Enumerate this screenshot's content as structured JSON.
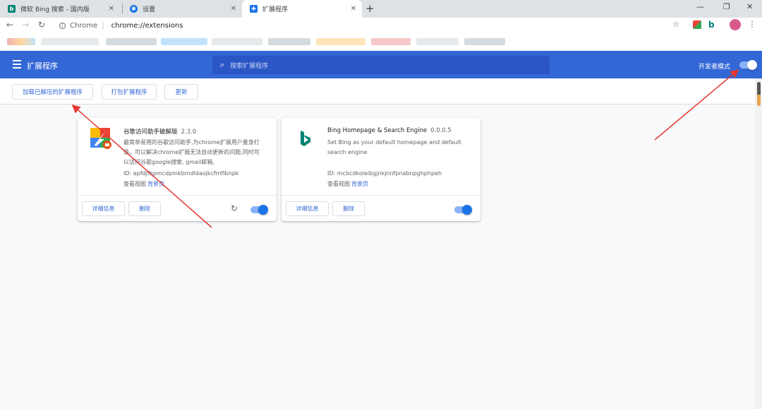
{
  "browser": {
    "tabs": [
      {
        "title": "微软 Bing 搜索 - 国内版",
        "icon": "bing-icon",
        "active": false
      },
      {
        "title": "设置",
        "icon": "settings-gear-icon",
        "active": false
      },
      {
        "title": "扩展程序",
        "icon": "puzzle-icon",
        "active": true
      }
    ],
    "newtab": "+",
    "address": {
      "scheme_label": "Chrome",
      "separator": "|",
      "url": "chrome://extensions"
    }
  },
  "header": {
    "title": "扩展程序",
    "search_placeholder": "搜索扩展程序",
    "dev_mode_label": "开发者模式",
    "dev_mode_on": true
  },
  "subbar": {
    "load_unpacked": "加载已解压的扩展程序",
    "pack": "打包扩展程序",
    "update": "更新"
  },
  "extensions": [
    {
      "name": "谷歌访问助手破解版",
      "version": "2.3.0",
      "description": "最简单易用的谷歌访问助手,为chrome扩展用户量身打造。可以解决chrome扩展无法自动更新的问题,同时可以访问谷歌google搜索, gmail邮箱,",
      "id_label": "ID: apfdjfhpmcdpmkbmdldaojkcfmfibnpk",
      "inspect_label": "查看视图",
      "background_link": "背景页",
      "details_button": "详细信息",
      "remove_button": "删除",
      "enabled": true
    },
    {
      "name": "Bing Homepage & Search Engine",
      "version": "0.0.0.5",
      "description": "Set Bing as your default homepage and default search engine",
      "id_label": "ID: mcbcdkoleibgjnkjnnfpnabnpghphpeh",
      "inspect_label": "查看视图",
      "background_link": "背景页",
      "details_button": "详细信息",
      "remove_button": "删除",
      "enabled": true
    }
  ],
  "colors": {
    "header_blue": "#3367d6",
    "search_blue": "#2a56c6",
    "toggle_knob": "#1a73e8",
    "toggle_track": "#8ab4f8",
    "bing_teal": "#008373",
    "annotation_red": "#e53935"
  }
}
